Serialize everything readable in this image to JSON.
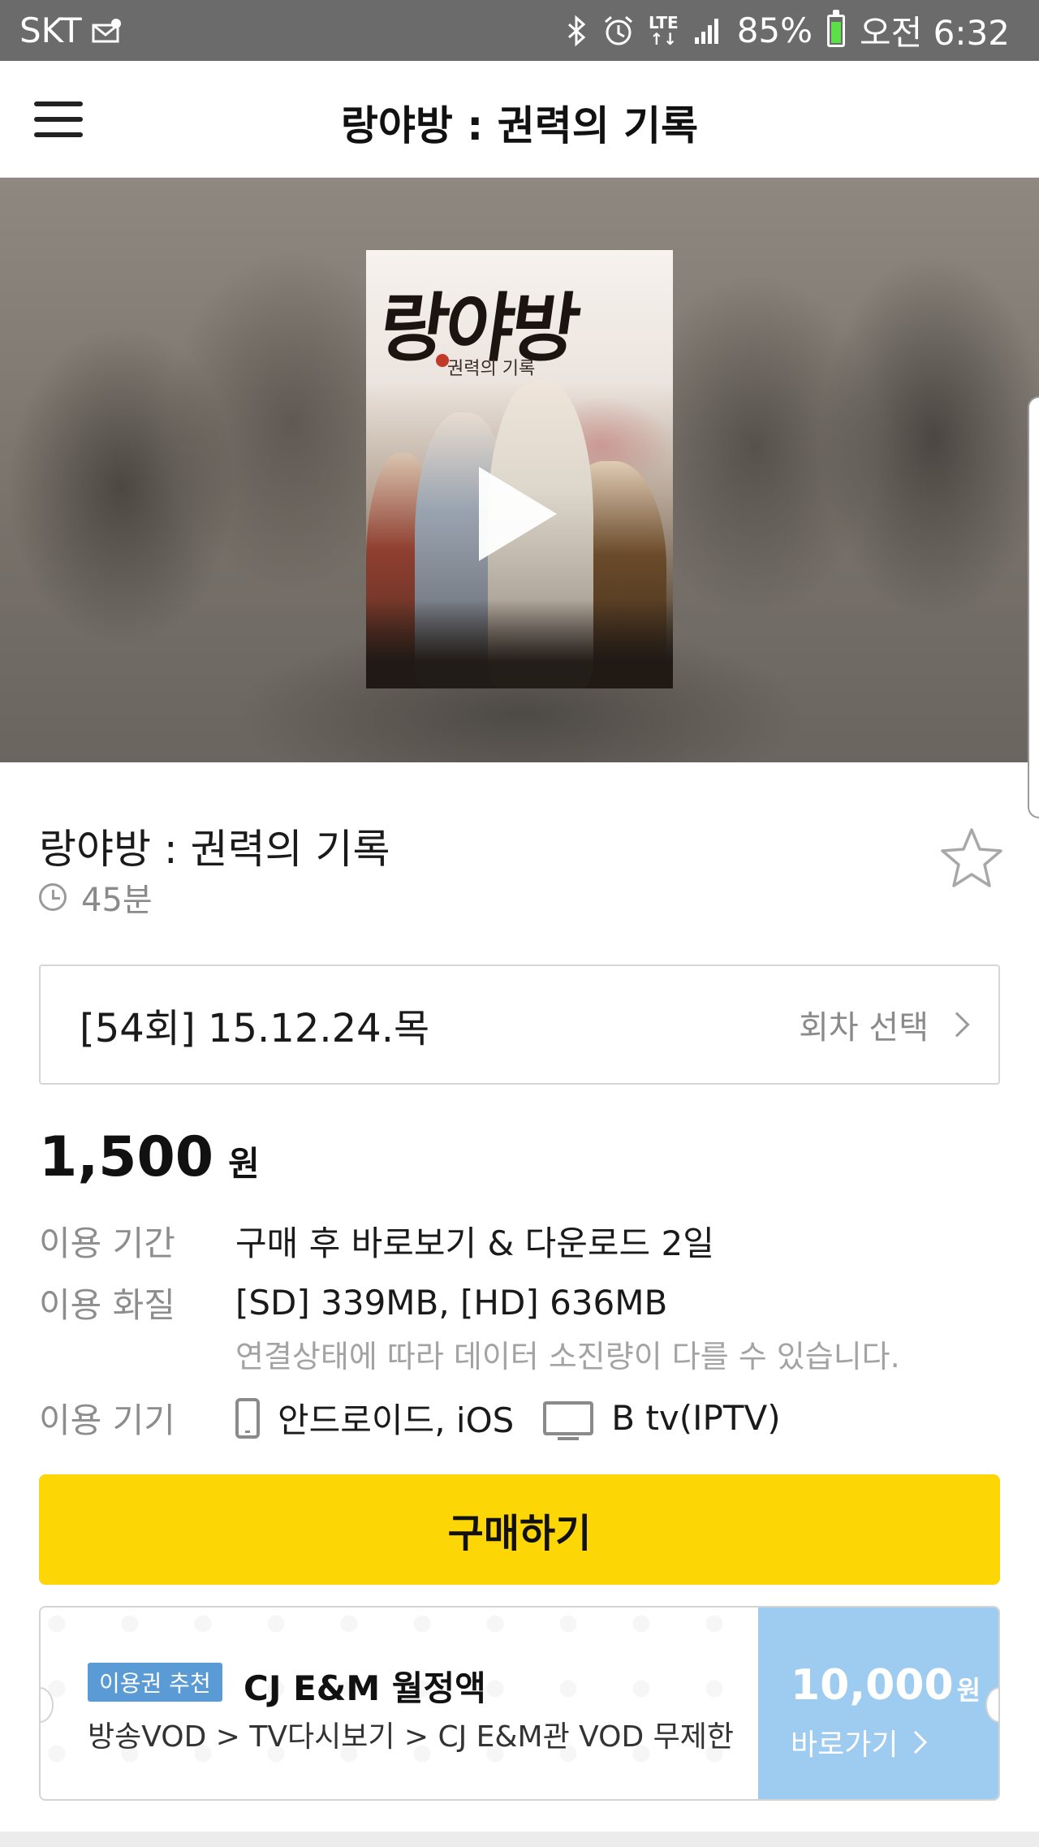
{
  "status_bar": {
    "carrier": "SKT",
    "network": "LTE",
    "battery": "85%",
    "time": "오전 6:32",
    "battery_color": "#5ce04a"
  },
  "header": {
    "title": "랑야방 : 권력의 기록",
    "menu_icon": "hamburger-menu-icon"
  },
  "hero": {
    "poster_logo": "랑야방",
    "poster_subtitle": "권력의 기록",
    "play_icon": "play-icon"
  },
  "content": {
    "title": "랑야방 : 권력의 기록",
    "duration": "45분",
    "favorite_icon": "star-outline-icon"
  },
  "episode": {
    "label": "[54회] 15.12.24.목",
    "action_label": "회차 선택"
  },
  "price": {
    "value": "1,500",
    "unit": "원"
  },
  "specs": {
    "period_label": "이용 기간",
    "period_value": "구매 후 바로보기 & 다운로드 2일",
    "quality_label": "이용 화질",
    "quality_value": "[SD] 339MB, [HD] 636MB",
    "quality_note": "연결상태에 따라 데이터 소진량이 다를 수 있습니다.",
    "device_label": "이용 기기",
    "device_mobile": "안드로이드, iOS",
    "device_tv": "B tv(IPTV)"
  },
  "buy_button": {
    "label": "구매하기",
    "color": "#fdd605"
  },
  "promo": {
    "badge": "이용권 추천",
    "title": "CJ E&M 월정액",
    "path": "방송VOD > TV다시보기 > CJ E&M관 VOD 무제한",
    "price_value": "10,000",
    "price_unit": "원",
    "go_label": "바로가기",
    "accent_color": "#9ecbf0",
    "badge_color": "#5a9bd6"
  }
}
